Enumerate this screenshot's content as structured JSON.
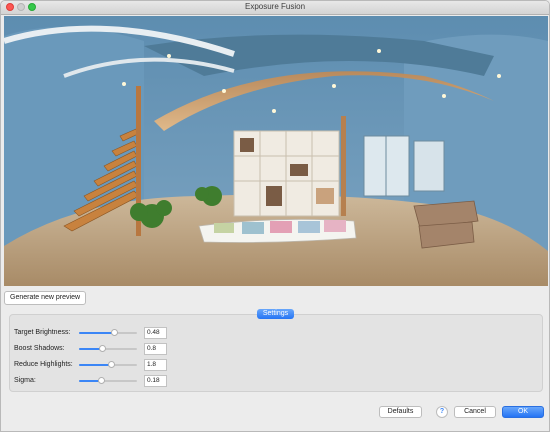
{
  "window": {
    "title": "Exposure Fusion"
  },
  "preview": {
    "description_icon": "panorama-preview-image",
    "generate_button_label": "Generate new preview"
  },
  "settings": {
    "tab_label": "Settings",
    "rows": [
      {
        "label": "Target Brightness:",
        "value": "0.48",
        "fraction": 0.6
      },
      {
        "label": "Boost Shadows:",
        "value": "0.8",
        "fraction": 0.4
      },
      {
        "label": "Reduce Highlights:",
        "value": "1.8",
        "fraction": 0.55
      },
      {
        "label": "Sigma:",
        "value": "0.18",
        "fraction": 0.38
      }
    ]
  },
  "footer": {
    "defaults_label": "Defaults",
    "help_label": "?",
    "cancel_label": "Cancel",
    "ok_label": "OK"
  },
  "colors": {
    "accent": "#2574f4",
    "close": "#fc5753",
    "maximize": "#35c84a"
  }
}
